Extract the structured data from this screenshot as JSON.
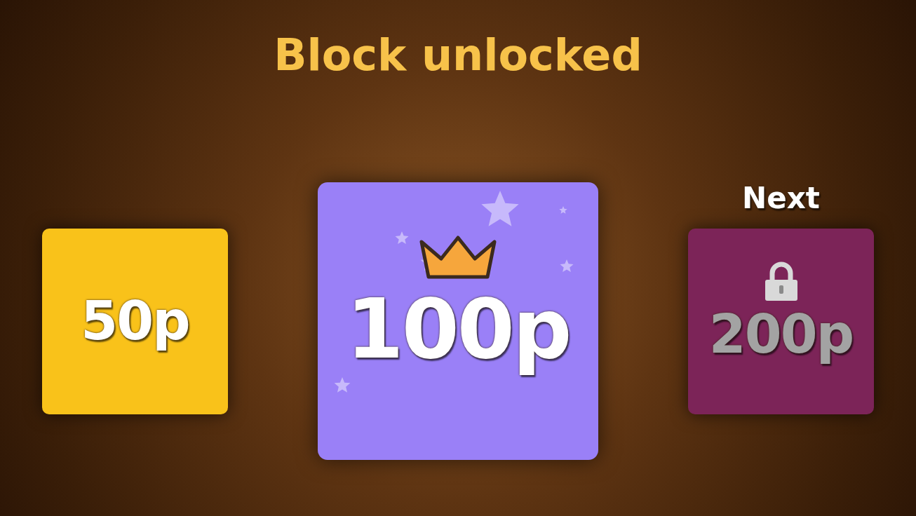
{
  "title": "Block unlocked",
  "blocks": [
    {
      "kind": "unlocked",
      "value": "50p",
      "color": "#f9c21a"
    },
    {
      "kind": "current",
      "value": "100p",
      "color": "#9a80f7"
    },
    {
      "kind": "locked",
      "value": "200p",
      "color": "#7c2458",
      "caption": "Next"
    }
  ]
}
